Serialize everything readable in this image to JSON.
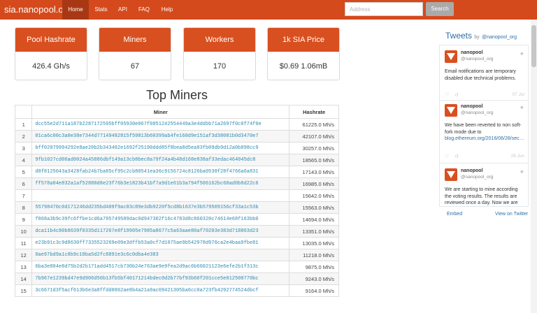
{
  "nav": {
    "brand": "sia.nanopool.org",
    "items": [
      "Home",
      "Stats",
      "API",
      "FAQ",
      "Help"
    ],
    "search_placeholder": "Address",
    "search_button": "Search"
  },
  "cards": [
    {
      "title": "Pool Hashrate",
      "value": "426.4 Gh/s"
    },
    {
      "title": "Miners",
      "value": "67"
    },
    {
      "title": "Workers",
      "value": "170"
    },
    {
      "title": "1k SIA Price",
      "value": "$0.69 1.06mB"
    }
  ],
  "top_miners": {
    "heading": "Top Miners",
    "columns": [
      "",
      "Miner",
      "Hashrate"
    ],
    "rows": [
      {
        "n": "1",
        "miner": "dcc55e2d711a187b2287172595bff05930e067f0851242554449a3e4ddbb71a2697f0c0f74f0e",
        "hashrate": "61225.0 Mh/s"
      },
      {
        "n": "2",
        "miner": "01ca6c00c3a0e38e7344d77149482815f59813b60399ab4fe160d9e151af3d38081b0d3470e7",
        "hashrate": "42107.0 Mh/s"
      },
      {
        "n": "3",
        "miner": "bff02079994292e8ae20b2b343482e1692f25190ddd85f8bea8d5ea83fb09db9d12a0b898cc9",
        "hashrate": "30257.0 Mh/s"
      },
      {
        "n": "4",
        "miner": "9fb1027cd06ad0024a45886dbf149a13cb8bec8a79f24a4b48d168e838af33edac464045dc8",
        "hashrate": "18565.0 Mh/s"
      },
      {
        "n": "5",
        "miner": "d8f8125043a3428fab24b7ba85cf95c2cb80541ea36c9156724c8126ba0538f28f4766a6a831",
        "hashrate": "17143.0 Mh/s"
      },
      {
        "n": "6",
        "miner": "ff578a04e832a1af52888d8e23f76b3e1823b41bf7a9d1e61b3a794f506162bc60ad0b8d22c6",
        "hashrate": "16985.0 Mh/s"
      },
      {
        "n": "7",
        "miner": "",
        "hashrate": "15642.0 Mh/s"
      },
      {
        "n": "8",
        "miner": "55798470c0d171246dd235bd409f9ac83c89e3db9220f5cd8b1637e3b579509156cf33a1c53b",
        "hashrate": "15563.0 Mh/s"
      },
      {
        "n": "9",
        "miner": "f868a3b9c39fc6ffbe1cd6a795749589dac0d947302f16c4783d8c860320c74614e68f163bb0",
        "hashrate": "14694.0 Mh/s"
      },
      {
        "n": "10",
        "miner": "dca11b4c80b8639f0335d117267e8f19905e7985a8677c5a63aae80af70203e383d718863d23",
        "hashrate": "13351.0 Mh/s"
      },
      {
        "n": "11",
        "miner": "e23b91c3c9d8630ff7335523269e09e3dffb53a0cf7d1075ae9b542978d976ca2e4baa9fbe81",
        "hashrate": "13035.0 Mh/s"
      },
      {
        "n": "12",
        "miner": "0ae97bd9a1c8b9c18ba5d2fc8891e3c6c0dba4e383",
        "hashrate": "11218.0 Mh/s"
      },
      {
        "n": "13",
        "miner": "6ba3e804e8d75b2d2b171add4517cb730b24e763ae9e9fea2d9ac6b66021123e6efe2b1f313c",
        "hashrate": "9875.0 Mh/s"
      },
      {
        "n": "14",
        "miner": "7b967e1239bd47e9d906d50b13fb5bf40171214bdec0d2b77bf93b60f201cce5e812500770bc",
        "hashrate": "9243.0 Mh/s"
      },
      {
        "n": "15",
        "miner": "3c6671d3f5acf613b6e3a8ffdd0862ae8b4a21a9ac09421305ba6cc0a723fb4292774524dbcf",
        "hashrate": "9164.0 Mh/s"
      }
    ]
  },
  "tweets": {
    "title": "Tweets",
    "by": "by",
    "handle": "@nanopool_org",
    "items": [
      {
        "name": "nanopool",
        "handle": "@nanopool_org",
        "text": "Email notifications are temporary disabled due technical problems.",
        "link": "",
        "date": "07 Jul"
      },
      {
        "name": "nanopool",
        "handle": "@nanopool_org",
        "text": "We have been reverted to non soft-fork mode due to",
        "link": "blog.ethereum.org/2016/06/28/sec…",
        "date": "28 Jun"
      },
      {
        "name": "nanopool",
        "handle": "@nanopool_org",
        "text": "We are starting to mine according the voting results. The results are reviewed once a day. Now we are",
        "link": "",
        "date": ""
      }
    ],
    "embed": "Embed",
    "view_on": "View on Twitter"
  }
}
